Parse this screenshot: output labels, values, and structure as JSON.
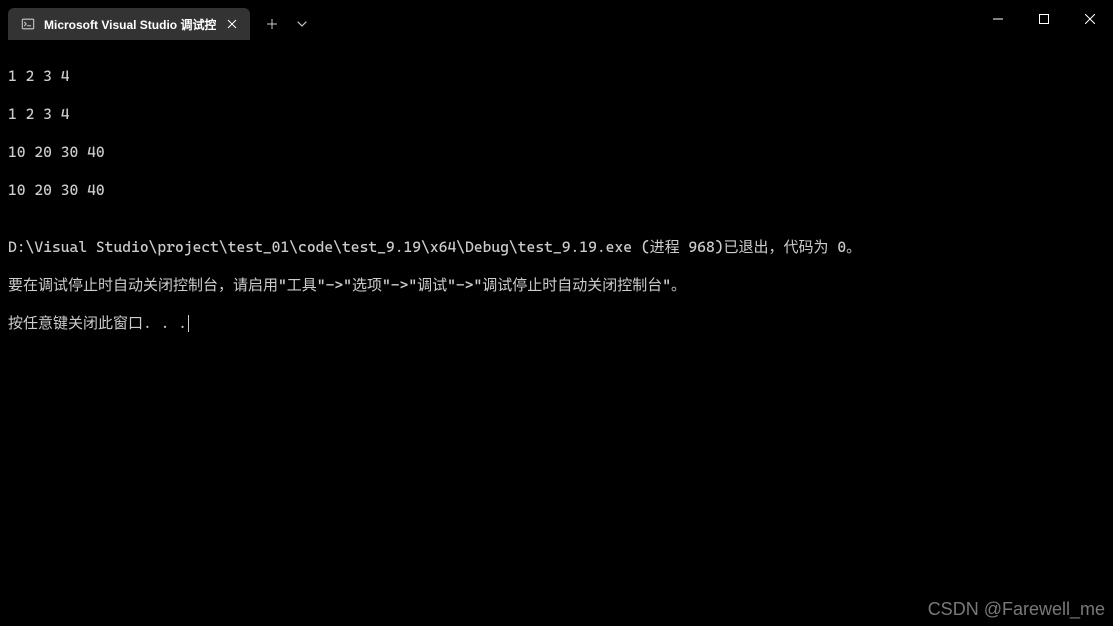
{
  "tab": {
    "title": "Microsoft Visual Studio 调试控"
  },
  "terminal": {
    "line1": "1 2 3 4",
    "line2": "1 2 3 4",
    "line3": "10 20 30 40",
    "line4": "10 20 30 40",
    "line5": "",
    "line6": "D:\\Visual Studio\\project\\test_01\\code\\test_9.19\\x64\\Debug\\test_9.19.exe (进程 968)已退出，代码为 0。",
    "line7": "要在调试停止时自动关闭控制台，请启用\"工具\"->\"选项\"->\"调试\"->\"调试停止时自动关闭控制台\"。",
    "line8": "按任意键关闭此窗口. . ."
  },
  "watermark": "CSDN @Farewell_me"
}
